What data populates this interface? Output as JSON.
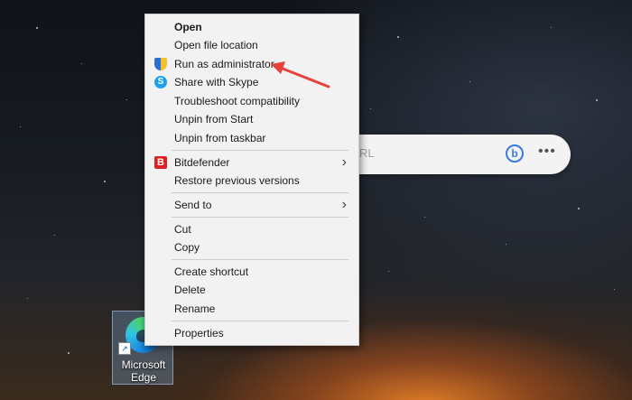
{
  "search_bar": {
    "placeholder": "RL"
  },
  "desktop_icon": {
    "label_line1": "Microsoft",
    "label_line2": "Edge"
  },
  "context_menu": {
    "items": [
      {
        "label": "Open",
        "bold": true
      },
      {
        "label": "Open file location"
      },
      {
        "label": "Run as administrator",
        "icon": "uac-shield-icon"
      },
      {
        "label": "Share with Skype",
        "icon": "skype-icon"
      },
      {
        "label": "Troubleshoot compatibility"
      },
      {
        "label": "Unpin from Start"
      },
      {
        "label": "Unpin from taskbar"
      },
      {
        "label": "Bitdefender",
        "icon": "bitdefender-icon",
        "submenu": true
      },
      {
        "label": "Restore previous versions"
      },
      {
        "label": "Send to",
        "submenu": true
      },
      {
        "label": "Cut"
      },
      {
        "label": "Copy"
      },
      {
        "label": "Create shortcut"
      },
      {
        "label": "Delete"
      },
      {
        "label": "Rename"
      },
      {
        "label": "Properties"
      }
    ]
  },
  "annotation": {
    "color": "#e8403a"
  },
  "icons": {
    "skype_letter": "S",
    "bitdefender_letter": "B",
    "bing_letter": "b",
    "more": "•••",
    "chevron": "›"
  }
}
